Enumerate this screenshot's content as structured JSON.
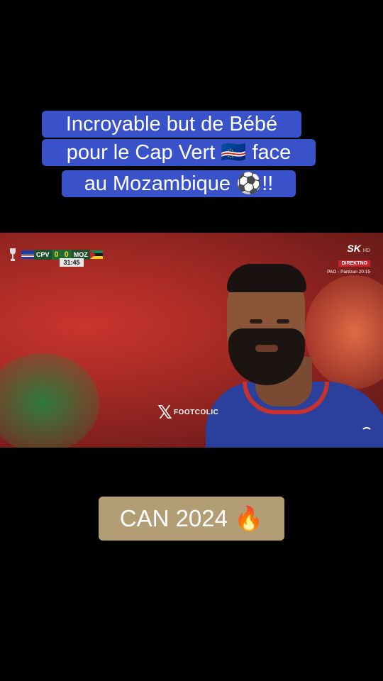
{
  "caption": {
    "line1": "Incroyable but de Bébé",
    "line2": "pour le Cap Vert 🇨🇻 face",
    "line3": "au Mozambique ⚽!!"
  },
  "scorebug": {
    "home_team": "CPV",
    "home_score": "0",
    "away_score": "0",
    "away_team": "MOZ",
    "clock": "31:45"
  },
  "broadcaster": {
    "logo": "SK",
    "quality": "HD",
    "live_label": "DIREKTNO",
    "next_program": "PAO - Partizan  20:15"
  },
  "watermark": {
    "icon": "x-icon",
    "text": "FOOTCOLIC"
  },
  "bottom_badge": "CAN 2024 🔥",
  "colors": {
    "caption_bg": "#3a52c9",
    "badge_bg": "#b39d74",
    "background": "#000000"
  }
}
